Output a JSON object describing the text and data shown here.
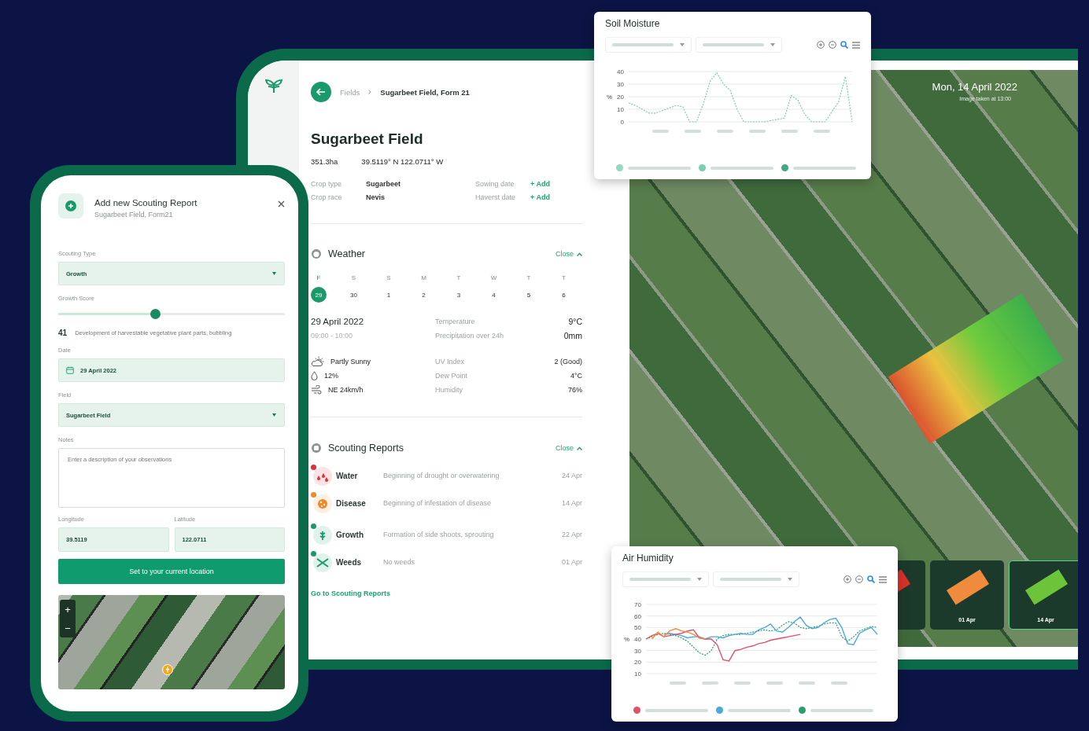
{
  "phone_form": {
    "title": "Add new Scouting Report",
    "subtitle": "Sugarbeet Field, Form21",
    "scouting_type": {
      "label": "Scouting Type",
      "value": "Growth"
    },
    "growth_score": {
      "label": "Growth Score",
      "level": 0.43,
      "score": "41",
      "description": "Development of harvestable vegetative plant parts, bubbling"
    },
    "date": {
      "label": "Date",
      "value": "29 April 2022"
    },
    "field": {
      "label": "Field",
      "value": "Sugarbeet Field"
    },
    "notes": {
      "label": "Notes",
      "placeholder": "Enter a description of your observations"
    },
    "longitude": {
      "label": "Longitude",
      "value": "39.5119"
    },
    "latitude": {
      "label": "Latitude",
      "value": "122.0711"
    },
    "location_button": "Set to your current location",
    "map_zoom": [
      "+",
      "−"
    ]
  },
  "field_page": {
    "breadcrumb": [
      "Fields",
      "Sugarbeet Field, Form 21"
    ],
    "title": "Sugarbeet Field",
    "area": "351.3ha",
    "coordinates": "39.5119° N 122.0711° W",
    "details": [
      {
        "label": "Crop type",
        "value": "Sugarbeet",
        "kind": "value"
      },
      {
        "label": "Sowing date",
        "value": "+ Add",
        "kind": "link"
      },
      {
        "label": "Crop race",
        "value": "Nevis",
        "kind": "value"
      },
      {
        "label": "Haverst date",
        "value": "+ Add",
        "kind": "link"
      }
    ],
    "weather": {
      "title": "Weather",
      "toggle": "Close",
      "days": [
        {
          "weekday": "F",
          "date": "29",
          "selected": true
        },
        {
          "weekday": "S",
          "date": "30",
          "selected": false
        },
        {
          "weekday": "S",
          "date": "1",
          "selected": false
        },
        {
          "weekday": "M",
          "date": "2",
          "selected": false
        },
        {
          "weekday": "T",
          "date": "3",
          "selected": false
        },
        {
          "weekday": "W",
          "date": "4",
          "selected": false
        },
        {
          "weekday": "T",
          "date": "5",
          "selected": false
        },
        {
          "weekday": "T",
          "date": "6",
          "selected": false
        }
      ],
      "date": "29 April 2022",
      "time": "09:00 - 10:00",
      "conditions": [
        {
          "kind": "sun",
          "text": "Partly Sunny"
        },
        {
          "kind": "drop",
          "text": "12%"
        },
        {
          "kind": "wind",
          "text": "NE 24km/h"
        }
      ],
      "metrics": [
        {
          "label": "Temperature",
          "value": "9°C"
        },
        {
          "label": "Precipitation over 24h",
          "value": "0mm"
        },
        {
          "label": "UV Index",
          "value": "2 (Good)"
        },
        {
          "label": "Dew Point",
          "value": "4°C"
        },
        {
          "label": "Humidity",
          "value": "76%"
        }
      ]
    },
    "scouting_reports": {
      "title": "Scouting Reports",
      "toggle": "Close",
      "reports": [
        {
          "kind": "water",
          "name": "Water",
          "description": "Beginning of drought or overwatering",
          "date": "24 Apr",
          "color": "#e0303c"
        },
        {
          "kind": "disease",
          "name": "Disease",
          "description": "Beginning of infestation of disease",
          "date": "14 Apr",
          "color": "#f08a24"
        },
        {
          "kind": "growth",
          "name": "Growth",
          "description": "Formation of side shoots, sprouting",
          "date": "22 Apr",
          "color": "#1a9a6a"
        },
        {
          "kind": "weeds",
          "name": "Weeds",
          "description": "No weeds",
          "date": "01 Apr",
          "color": "#1a9a6a"
        }
      ],
      "link": "Go to Scouting Reports"
    }
  },
  "map": {
    "date": "Mon, 14 April 2022",
    "caption": "Image taken at 13:00",
    "thumbnails": [
      {
        "color": "#d9322a",
        "selected": false
      },
      {
        "label": "01 Apr",
        "color": "#f08a3c",
        "selected": false
      },
      {
        "label": "14 Apr",
        "color": "#6cc43a",
        "selected": true
      }
    ]
  },
  "soil_moisture": {
    "legend": [
      {
        "color": "#93d9c0"
      },
      {
        "color": "#7ccdb0"
      },
      {
        "color": "#3daa85"
      }
    ],
    "chart_data": {
      "type": "line",
      "title": "Soil Moisture",
      "ylabel": "%",
      "ylim": [
        0,
        40
      ],
      "yticks": [
        0,
        10,
        20,
        30,
        40
      ],
      "grid": true,
      "series": [
        {
          "color": "#7ccdb0",
          "line_style": "dashed",
          "values": [
            15,
            13,
            10,
            7,
            7,
            9,
            11,
            13,
            12,
            0,
            0,
            14,
            32,
            39,
            30,
            25,
            10,
            0,
            0,
            0,
            0,
            1,
            2,
            3,
            21,
            17,
            6,
            0,
            0,
            0,
            8,
            16,
            36,
            0
          ]
        }
      ]
    }
  },
  "air_humidity": {
    "legend": [
      {
        "color": "#e05068"
      },
      {
        "color": "#4aa8dc"
      },
      {
        "color": "#2a9d6e"
      }
    ],
    "chart_data": {
      "type": "line",
      "title": "Air Humidity",
      "ylabel": "%",
      "ylim": [
        10,
        70
      ],
      "yticks": [
        10,
        20,
        30,
        40,
        50,
        60,
        70
      ],
      "grid": true,
      "series": [
        {
          "color": "#2a9d6e",
          "line_style": "dashed",
          "values": [
            40,
            42,
            44,
            45,
            44,
            43,
            41,
            38,
            33,
            28,
            26,
            30,
            40,
            43,
            44,
            44,
            44,
            45,
            46,
            47,
            48,
            47,
            48,
            52,
            55,
            54,
            50,
            49,
            50,
            51,
            53,
            54,
            54,
            42,
            38,
            42,
            47,
            49,
            51,
            50
          ]
        },
        {
          "color": "#4aa8dc",
          "line_style": "solid",
          "values": [
            null,
            null,
            null,
            44,
            45,
            44,
            43,
            41,
            42,
            42,
            40,
            42,
            42,
            41,
            43,
            44,
            45,
            44,
            44,
            48,
            50,
            53,
            47,
            46,
            50,
            55,
            59,
            52,
            49,
            50,
            54,
            57,
            58,
            50,
            36,
            35,
            45,
            48,
            50,
            44
          ]
        },
        {
          "color": "#e05068",
          "line_style": "solid",
          "values": [
            40,
            43,
            45,
            42,
            43,
            44,
            45,
            47,
            48,
            41,
            40,
            40,
            35,
            22,
            21,
            30,
            31,
            33,
            34,
            36,
            37,
            39,
            40,
            41,
            42,
            43,
            44,
            null,
            null,
            null,
            null,
            null,
            null,
            null,
            null,
            null,
            null,
            null,
            null,
            null
          ]
        },
        {
          "color": "#f08a3c",
          "line_style": "solid",
          "values": [
            null,
            40,
            46,
            42,
            47,
            49,
            47,
            46,
            44,
            41,
            40,
            null,
            null,
            null,
            null,
            null,
            null,
            null,
            null,
            null,
            null,
            null,
            null,
            null,
            null,
            null,
            null,
            null,
            null,
            null,
            null,
            null,
            null,
            null,
            null,
            null,
            null,
            null,
            null,
            null
          ]
        }
      ]
    }
  }
}
